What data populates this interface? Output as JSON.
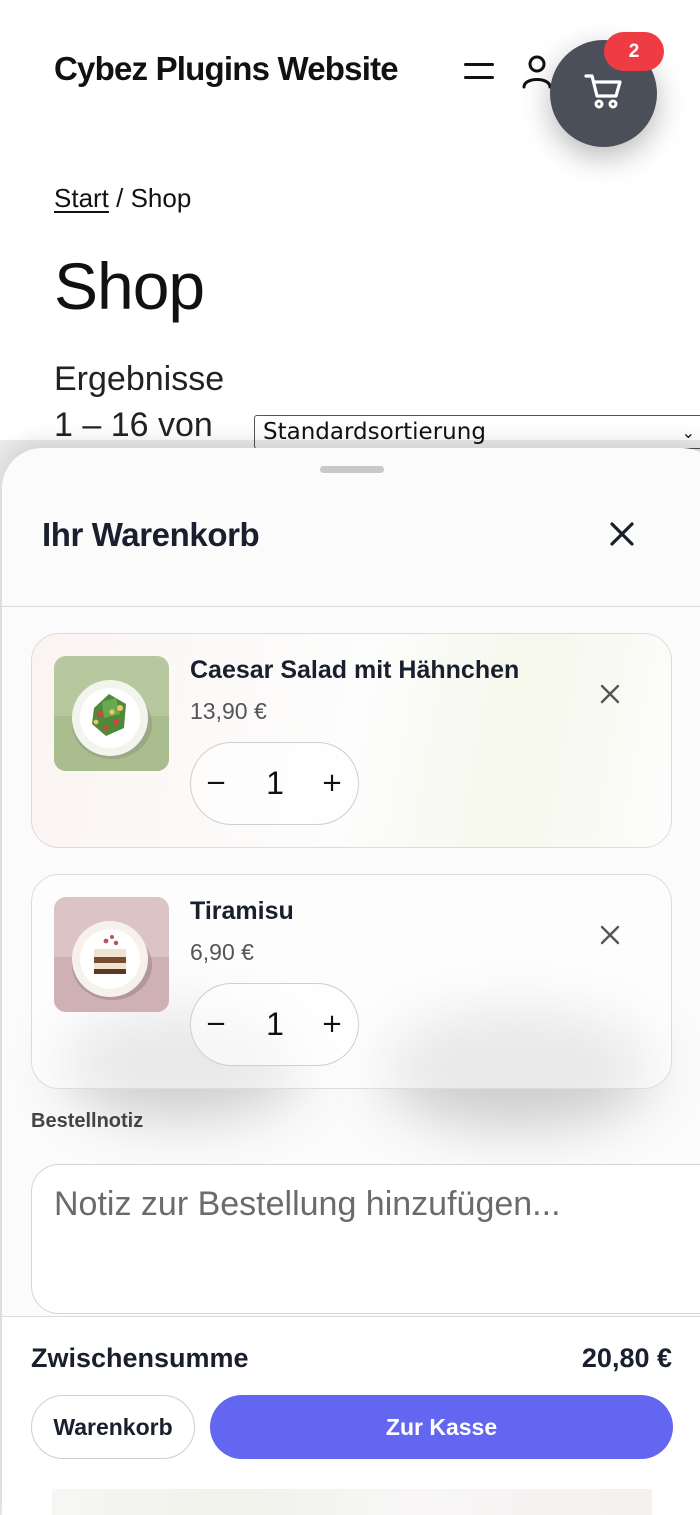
{
  "header": {
    "site_title": "Cybez Plugins Website",
    "menu_icon": "hamburger-menu-icon",
    "account_icon": "user-icon",
    "cart_icon": "shopping-cart-icon",
    "cart_count": "2"
  },
  "breadcrumb": {
    "home": "Start",
    "separator": " / ",
    "current": "Shop"
  },
  "page": {
    "title": "Shop",
    "result_count": "Ergebnisse 1 – 16 von",
    "sort_selected": "Standardsortierung"
  },
  "cart": {
    "title": "Ihr Warenkorb",
    "close_icon": "close-icon",
    "items": [
      {
        "name": "Caesar Salad mit Hähnchen",
        "price": "13,90 €",
        "quantity": "1"
      },
      {
        "name": "Tiramisu",
        "price": "6,90 €",
        "quantity": "1"
      }
    ],
    "qty_minus": "−",
    "qty_plus": "+",
    "note_label": "Bestellnotiz",
    "note_placeholder": "Notiz zur Bestellung hinzufügen...",
    "subtotal_label": "Zwischensumme",
    "subtotal_value": "20,80 €",
    "view_cart_label": "Warenkorb",
    "checkout_label": "Zur Kasse"
  },
  "colors": {
    "accent": "#6366f1",
    "badge": "#ef3b43",
    "cart_button": "#4b4f5a"
  }
}
